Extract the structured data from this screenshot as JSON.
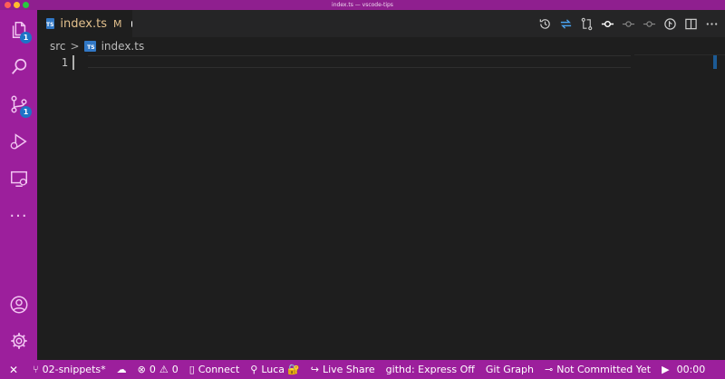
{
  "window": {
    "title": "index.ts — vscode-tips"
  },
  "activity_bar": {
    "explorer_badge": "1",
    "scm_badge": "1",
    "more": "···"
  },
  "tab": {
    "icon_label": "TS",
    "name": "index.ts",
    "status": "M"
  },
  "breadcrumb": {
    "folder": "src",
    "separator": ">",
    "file": "index.ts"
  },
  "editor": {
    "line_numbers": [
      "1"
    ]
  },
  "status_bar": {
    "branch": "02-snippets*",
    "errors": "0",
    "warnings": "0",
    "connect": "Connect",
    "user": "Luca",
    "live_share": "Live Share",
    "githd": "githd: Express Off",
    "git_graph": "Git Graph",
    "blame": "Not Committed Yet",
    "timer": "00:00"
  },
  "colors": {
    "accent": "#9c1f9c",
    "editor_bg": "#1e1e1e",
    "badge": "#1d74c7",
    "modified": "#e2c08d",
    "ts": "#3178c6"
  }
}
